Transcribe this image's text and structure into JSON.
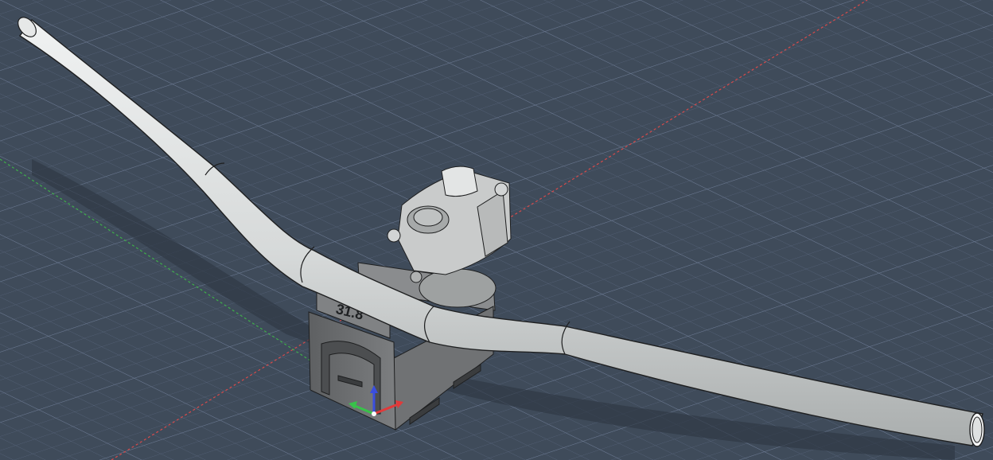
{
  "viewport": {
    "background_color": "#3f4b5a",
    "grid_minor_color": "#56637a",
    "grid_major_color": "#6a7890",
    "x_axis_color": "#d84a4a",
    "y_axis_color": "#3fae4a"
  },
  "model": {
    "handlebar_color": "#d9dcdc",
    "handlebar_outline": "#1e1f20",
    "stem_color": "#c9cbcb",
    "fixture_color": "#6b6d6f",
    "fixture_label": "31.8"
  },
  "gizmo": {
    "x_color": "#e03a3a",
    "y_color": "#38c24a",
    "z_color": "#3a4ee0",
    "icon": "axis-triad-icon"
  }
}
